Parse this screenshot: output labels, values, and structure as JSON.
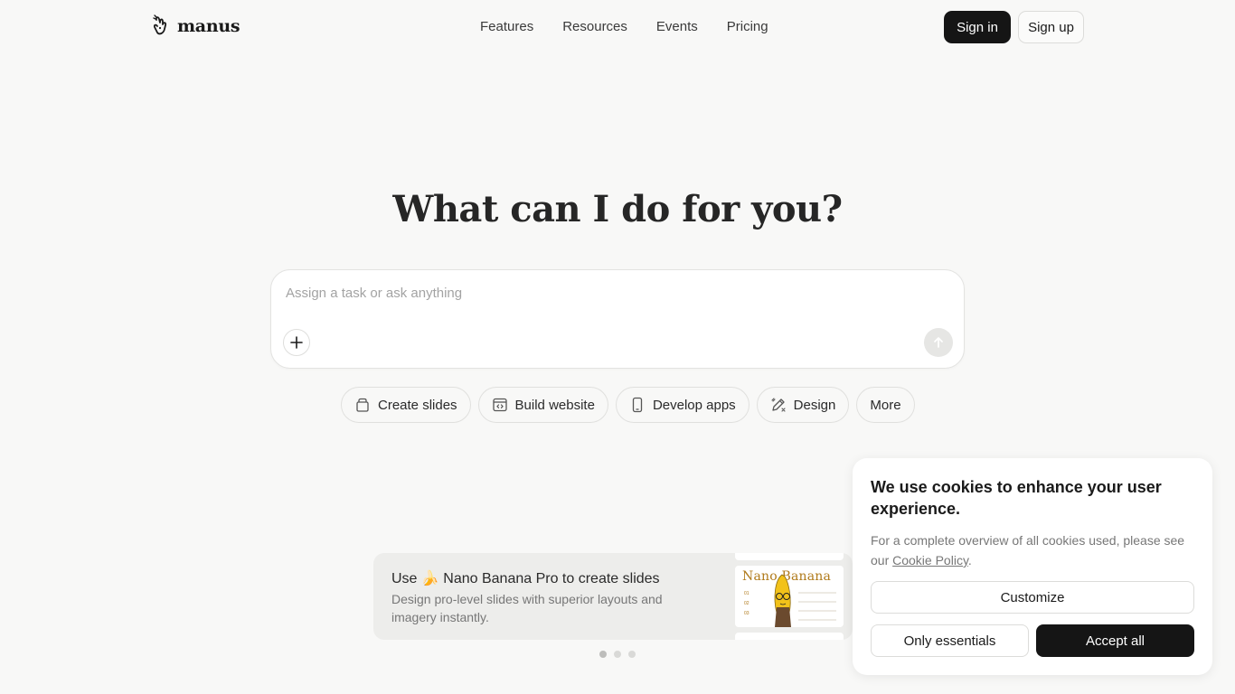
{
  "header": {
    "logo_text": "manus",
    "nav": [
      "Features",
      "Resources",
      "Events",
      "Pricing"
    ],
    "sign_in": "Sign in",
    "sign_up": "Sign up"
  },
  "hero": {
    "title": "What can I do for you?",
    "input_placeholder": "Assign a task or ask anything"
  },
  "chips": [
    {
      "label": "Create slides",
      "icon": "slides-icon"
    },
    {
      "label": "Build website",
      "icon": "website-icon"
    },
    {
      "label": "Develop apps",
      "icon": "phone-icon"
    },
    {
      "label": "Design",
      "icon": "design-pen-icon"
    },
    {
      "label": "More",
      "icon": ""
    }
  ],
  "promo": {
    "title_prefix": "Use",
    "emoji": "🍌",
    "title_suffix": "Nano Banana Pro to create slides",
    "description": "Design pro-level slides with superior layouts and imagery instantly.",
    "thumb_title": "Nano Banana",
    "active_slide": 1,
    "slide_count": 3
  },
  "cookie": {
    "title": "We use cookies to enhance your user experience.",
    "text": "For a complete overview of all cookies used, please see our",
    "link": "Cookie Policy",
    "text_end": ".",
    "customize": "Customize",
    "essentials": "Only essentials",
    "accept": "Accept all"
  },
  "colors": {
    "background": "#f8f8f7",
    "primary_button": "#151515",
    "promo_card": "#ededeb",
    "thumb_accent": "#b07a1a"
  }
}
